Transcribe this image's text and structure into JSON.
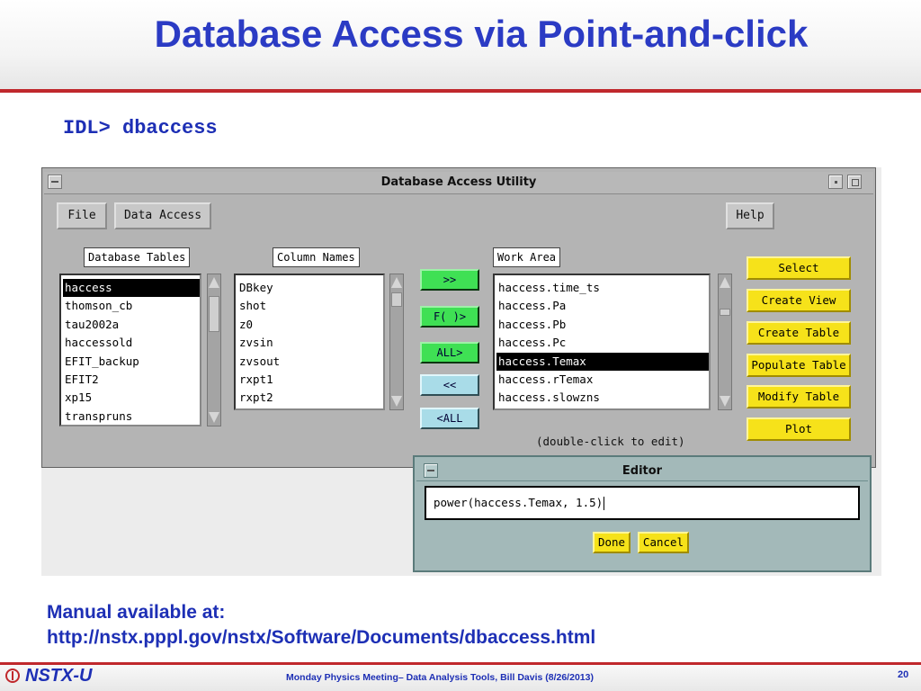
{
  "slide": {
    "title": "Database Access via Point-and-click",
    "command": "IDL> dbaccess",
    "manual_line1": "Manual available at:",
    "manual_line2": "http://nstx.pppl.gov/nstx/Software/Documents/dbaccess.html",
    "footer_logo": "NSTX-U",
    "footer_text": "Monday Physics Meeting– Data Analysis Tools,  Bill Davis (8/26/2013)",
    "page_number": "20"
  },
  "window": {
    "title": "Database Access Utility",
    "file_label": "File",
    "data_access_label": "Data Access",
    "help_label": "Help",
    "tables_label": "Database Tables",
    "columns_label": "Column Names",
    "work_area_label": "Work Area",
    "tables": [
      "haccess",
      "thomson_cb",
      "tau2002a",
      "haccessold",
      "EFIT_backup",
      "EFIT2",
      "xp15",
      "transpruns"
    ],
    "tables_selected": 0,
    "columns": [
      "DBkey",
      "shot",
      "z0",
      "zvsin",
      "zvsout",
      "rxpt1",
      "rxpt2"
    ],
    "work_area": [
      "haccess.time_ts",
      "haccess.Pa",
      "haccess.Pb",
      "haccess.Pc",
      "haccess.Temax",
      "haccess.rTemax",
      "haccess.slowzns"
    ],
    "work_area_selected": 4,
    "move_buttons": {
      "add": ">>",
      "func": "F( )>",
      "all": "ALL>",
      "remove": "<<",
      "remove_all": "<ALL"
    },
    "action_buttons": [
      "Select",
      "Create View",
      "Create Table",
      "Populate Table",
      "Modify Table",
      "Plot"
    ],
    "hint": "(double-click to edit)"
  },
  "editor": {
    "title": "Editor",
    "value": "power(haccess.Temax, 1.5)",
    "done_label": "Done",
    "cancel_label": "Cancel"
  },
  "colors": {
    "title_blue": "#2b3bc4",
    "accent_red": "#c0282c",
    "button_yellow": "#f6e21a",
    "button_green": "#3fe054",
    "button_cyan": "#a9dce8",
    "window_gray": "#b4b4b4",
    "editor_teal": "#a3b9b9"
  },
  "icons": [
    "window-menu-icon",
    "minimize-icon",
    "maximize-icon",
    "scroll-up-arrow-icon",
    "scroll-down-arrow-icon",
    "text-cursor-icon",
    "nstx-logo-icon"
  ]
}
